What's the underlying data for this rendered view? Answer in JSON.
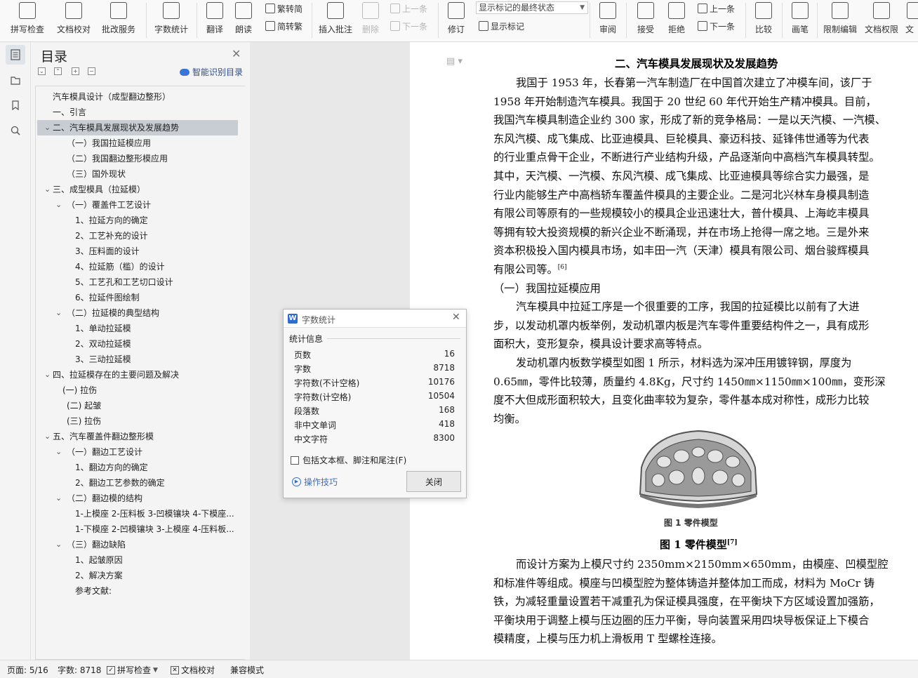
{
  "ribbon": {
    "spell_check": "拼写检查",
    "doc_proof": "文档校对",
    "batch_service": "批改服务",
    "word_count": "字数统计",
    "translate": "翻译",
    "read_aloud": "朗读",
    "trad_to_simp": "繁转简",
    "simp_to_trad": "简转繁",
    "insert_comment": "插入批注",
    "delete": "删除",
    "prev_comment": "上一条",
    "next_comment": "下一条",
    "track_changes": "修订",
    "markup_mode": "显示标记的最终状态",
    "show_markup": "显示标记",
    "review": "审阅",
    "accept": "接受",
    "reject": "拒绝",
    "prev_change": "上一条",
    "next_change": "下一条",
    "compare": "比较",
    "pen": "画笔",
    "restrict_edit": "限制编辑",
    "doc_permission": "文档权限",
    "cut_off": "文"
  },
  "toc": {
    "title": "目录",
    "smart_label": "智能识别目录",
    "items": [
      "汽车模具设计（成型翻边整形）",
      "一、引言",
      "二、汽车模具发展现状及发展趋势",
      "（一）我国拉延模应用",
      "（二）我国翻边整形模应用",
      "（三）国外现状",
      "三、成型模具（拉延模）",
      "（一）覆盖件工艺设计",
      "1、拉延方向的确定",
      "2、工艺补充的设计",
      "3、压料面的设计",
      "4、拉延筋（槛）的设计",
      "5、工艺孔和工艺切口设计",
      "6、拉延件图绘制",
      "（二）拉延模的典型结构",
      "1、单动拉延模",
      "2、双动拉延模",
      "3、三动拉延模",
      "四、拉延模存在的主要问题及解决",
      "(一) 拉伤",
      "(二) 起皱",
      "(三) 拉伤",
      "五、汽车覆盖件翻边整形模",
      "（一）翻边工艺设计",
      "1、翻边方向的确定",
      "2、翻边工艺参数的确定",
      "（二）翻边模的结构",
      "1-上模座 2-压料板 3-凹模镶块 4-下模座...",
      "1-下模座 2-凹模镶块 3-上模座 4-压料板...",
      "（三）翻边缺陷",
      "1、起皱原因",
      "2、解决方案",
      "参考文献:"
    ]
  },
  "document": {
    "heading": "二、汽车模具发展现状及发展趋势",
    "para1": [
      "我国于 1953 年，长春第一汽车制造厂在中国首次建立了冲模车间，该厂于",
      "1958 年开始制造汽车模具。我国于 20 世纪 60 年代开始生产精冲模具。目前，",
      "我国汽车模具制造企业约 300 家，形成了新的竞争格局：一是以天汽模、一汽模、",
      "东风汽模、成飞集成、比亚迪模具、巨轮模具、豪迈科技、延锋伟世通等为代表",
      "的行业重点骨干企业，不断进行产业结构升级，产品逐渐向中高档汽车模具转型。",
      "其中，天汽模、一汽模、东风汽模、成飞集成、比亚迪模具等综合实力最强，是",
      "行业内能够生产中高档轿车覆盖件模具的主要企业。二是河北兴林车身模具制造",
      "有限公司等原有的一些规模较小的模具企业迅速壮大，普什模具、上海屹丰模具",
      "等拥有较大投资规模的新兴企业不断涌现，并在市场上抢得一席之地。三是外来",
      "资本积极投入国内模具市场，如丰田一汽（天津）模具有限公司、烟台骏辉模具",
      "有限公司等。"
    ],
    "ref6": "[6]",
    "subheading": "（一）我国拉延模应用",
    "para2": [
      "汽车模具中拉延工序是一个很重要的工序，我国的拉延模比以前有了大进",
      "步，以发动机罩内板举例，发动机罩内板是汽车零件重要结构件之一，具有成形",
      "面积大，变形复杂，模具设计要求高等特点。"
    ],
    "para3": [
      "发动机罩内板数学模型如图  1 所示，材料选为深冲压用镀锌钢，厚度为",
      "0.65㎜，零件比较薄，质量约  4.8Kg，尺寸约  1450㎜×1150㎜×100㎜，变形深",
      "度不大但成形面积较大，且变化曲率较为复杂，零件基本成对称性，成形力比较",
      "均衡。"
    ],
    "figure_inner_label": "图 1    零件模型",
    "figure_caption": "图 1  零件模型",
    "ref7": "[7]",
    "para4": [
      "而设计方案为上模尺寸约  2350mm×2150mm×650mm，由模座、凹模型腔",
      "和标准件等组成。模座与凹模型腔为整体铸造并整体加工而成，材料为  MoCr  铸",
      "铁，为减轻重量设置若干减重孔为保证模具强度，在平衡块下方区域设置加强筋，",
      "平衡块用于调整上模与压边圈的压力平衡，导向装置采用四块导板保证上下模合",
      "模精度，上模与压力机上滑板用  T  型螺栓连接。"
    ]
  },
  "dialog": {
    "title": "字数统计",
    "section": "统计信息",
    "stats": [
      {
        "label": "页数",
        "value": "16"
      },
      {
        "label": "字数",
        "value": "8718"
      },
      {
        "label": "字符数(不计空格)",
        "value": "10176"
      },
      {
        "label": "字符数(计空格)",
        "value": "10504"
      },
      {
        "label": "段落数",
        "value": "168"
      },
      {
        "label": "非中文单词",
        "value": "418"
      },
      {
        "label": "中文字符",
        "value": "8300"
      }
    ],
    "include_label": "包括文本框、脚注和尾注(F)",
    "tips": "操作技巧",
    "close": "关闭"
  },
  "status": {
    "page": "页面: 5/16",
    "words": "字数: 8718",
    "spell": "拼写检查",
    "proof": "文档校对",
    "compat": "兼容模式"
  }
}
